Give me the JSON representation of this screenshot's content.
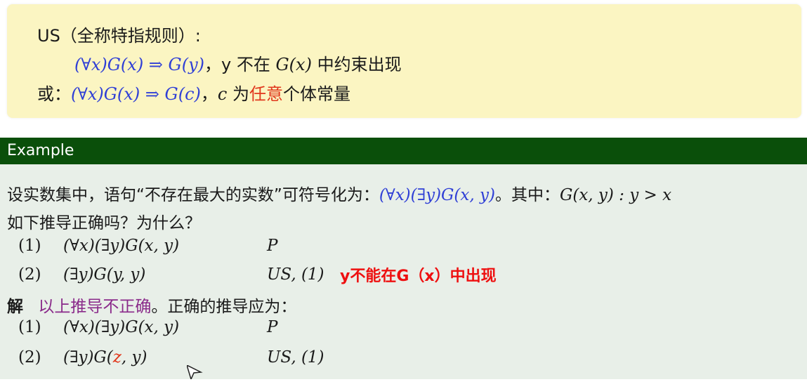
{
  "rule": {
    "heading": "US（全称特指规则）:",
    "line1_formula": "(∀x)G(x) ⇒ G(y)",
    "line1_sep": "，y",
    "line1_text1": "不在",
    "line1_gx": "G(x)",
    "line1_text2": "中约束出现",
    "line2_prefix": "或：",
    "line2_formula": "(∀x)G(x) ⇒ G(c)",
    "line2_sep": "，",
    "line2_c": "c",
    "line2_text1": "为",
    "line2_highlight": "任意",
    "line2_text2": "个体常量"
  },
  "example": {
    "header": "Example",
    "intro_text": "设实数集中，语句“不存在最大的实数”可符号化为：",
    "intro_formula": "(∀x)(∃y)G(x, y)",
    "intro_mid": "。其中：",
    "intro_def": "G(x, y) : y > x",
    "question": "如下推导正确吗？为什么？",
    "steps1": [
      {
        "num": "(1)",
        "formula": "(∀x)(∃y)G(x, y)",
        "reason": "P"
      },
      {
        "num": "(2)",
        "formula": "(∃y)G(y, y)",
        "reason": "US, (1)"
      }
    ],
    "annotation": "y不能在G（x）中出现",
    "answer_label": "解",
    "answer_highlight": "以上推导不正确",
    "answer_rest": "。正确的推导应为：",
    "steps2": [
      {
        "num": "(1)",
        "formula": "(∀x)(∃y)G(x, y)",
        "reason": "P"
      },
      {
        "num": "(2)",
        "formula_pre": "(∃y)G(",
        "formula_var": "z",
        "formula_post": ", y)",
        "reason": "US, (1)"
      }
    ]
  },
  "colors": {
    "rule_bg": "#fbf5c2",
    "header_bg": "#0a4f0a",
    "body_bg": "#e8efe8",
    "formula": "#2f3fd6",
    "highlight_red": "#e1371c",
    "highlight_purple": "#8a2a8a",
    "annotation": "#ee1010"
  }
}
